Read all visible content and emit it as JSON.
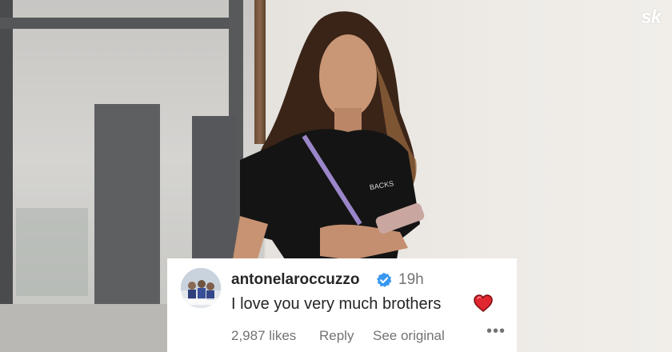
{
  "watermark": {
    "logo_text": "sk"
  },
  "comment": {
    "username": "antonelaroccuzzo",
    "verified": true,
    "timestamp": "19h",
    "text": "I love you very much brothers",
    "emoji": "heart-red",
    "likes": "2,987 likes",
    "reply_label": "Reply",
    "see_original_label": "See original",
    "more_label": "•••"
  },
  "colors": {
    "verified_badge": "#3897f0",
    "heart": "#e0262f",
    "text_primary": "#262626",
    "text_secondary": "#737373",
    "card_background": "#ffffff"
  }
}
